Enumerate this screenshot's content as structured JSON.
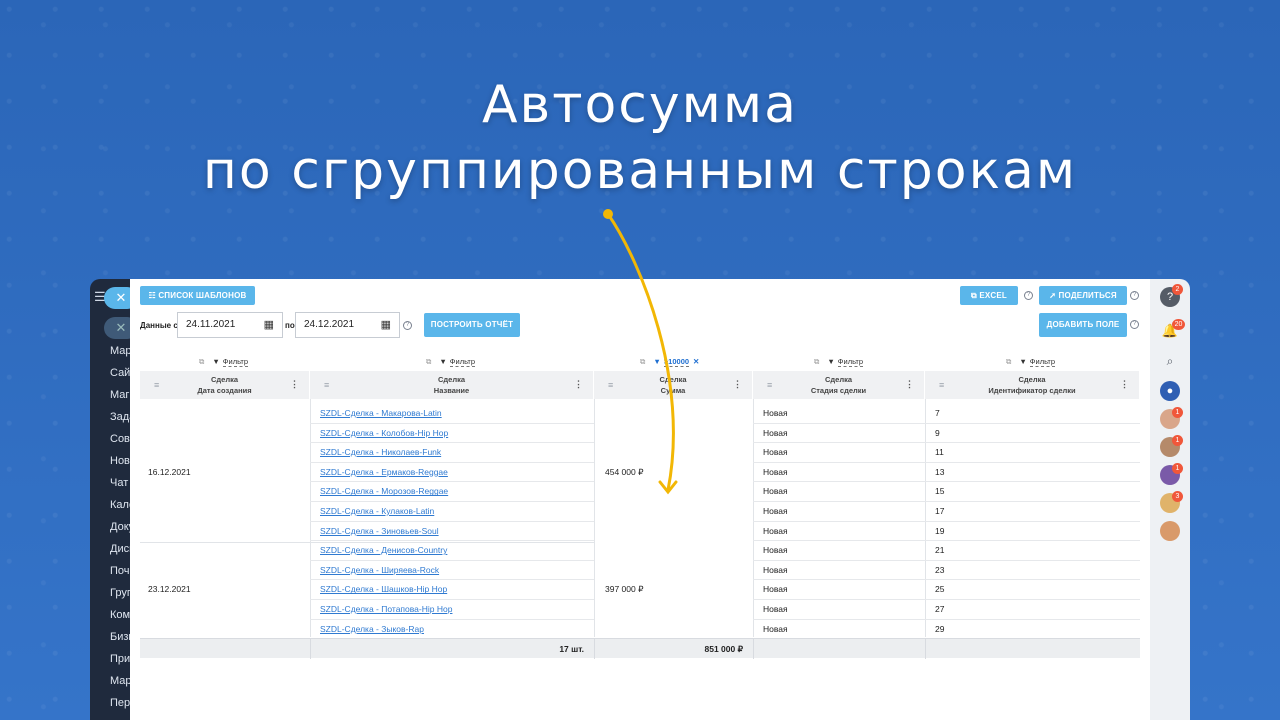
{
  "headline": {
    "line1": "Автосумма",
    "line2": "по сгруппированным строкам"
  },
  "left_sidebar": {
    "items": [
      "Мар",
      "Сайт",
      "Маг",
      "Зада",
      "Совм",
      "Нов",
      "Чат",
      "Кале",
      "Доку",
      "Диск",
      "Поч",
      "Груп",
      "Ком",
      "Бизн",
      "Прил",
      "Мар",
      "Пер"
    ]
  },
  "toolbar": {
    "templates_label": "СПИСОК ШАБЛОНОВ",
    "excel_label": "EXCEL",
    "share_label": "ПОДЕЛИТЬСЯ",
    "add_field_label": "ДОБАВИТЬ ПОЛЕ",
    "build_report_label": "ПОСТРОИТЬ ОТЧЁТ",
    "data_from_label": "Данные с",
    "to_label": "по",
    "date_from": "24.11.2021",
    "date_to": "24.12.2021"
  },
  "filters": {
    "label": "Фильтр",
    "active_value": ">10000"
  },
  "columns": [
    {
      "entity": "Сделка",
      "field": "Дата создания"
    },
    {
      "entity": "Сделка",
      "field": "Название"
    },
    {
      "entity": "Сделка",
      "field": "Сумма"
    },
    {
      "entity": "Сделка",
      "field": "Стадия сделки"
    },
    {
      "entity": "Сделка",
      "field": "Идентификатор сделки"
    }
  ],
  "groups": [
    {
      "date": "16.12.2021",
      "sum": "454 000 ₽",
      "rows": [
        {
          "name": "SZDL-Сделка - Макарова-Latin",
          "stage": "Новая",
          "id": "7"
        },
        {
          "name": "SZDL-Сделка - Колобов-Hip Hop",
          "stage": "Новая",
          "id": "9"
        },
        {
          "name": "SZDL-Сделка - Николаев-Funk",
          "stage": "Новая",
          "id": "11"
        },
        {
          "name": "SZDL-Сделка - Ермаков-Reggae",
          "stage": "Новая",
          "id": "13"
        },
        {
          "name": "SZDL-Сделка - Морозов-Reggae",
          "stage": "Новая",
          "id": "15"
        },
        {
          "name": "SZDL-Сделка - Кулаков-Latin",
          "stage": "Новая",
          "id": "17"
        },
        {
          "name": "SZDL-Сделка - Зиновьев-Soul",
          "stage": "Новая",
          "id": "19"
        }
      ]
    },
    {
      "date": "23.12.2021",
      "sum": "397 000 ₽",
      "rows": [
        {
          "name": "SZDL-Сделка - Денисов-Country",
          "stage": "Новая",
          "id": "21"
        },
        {
          "name": "SZDL-Сделка - Ширяева-Rock",
          "stage": "Новая",
          "id": "23"
        },
        {
          "name": "SZDL-Сделка - Шашков-Hip Hop",
          "stage": "Новая",
          "id": "25"
        },
        {
          "name": "SZDL-Сделка - Потапова-Hip Hop",
          "stage": "Новая",
          "id": "27"
        },
        {
          "name": "SZDL-Сделка - Зыков-Rap",
          "stage": "Новая",
          "id": "29"
        }
      ]
    }
  ],
  "totals": {
    "count": "17 шт.",
    "sum": "851 000 ₽"
  },
  "right_rail": {
    "help_badge": "2",
    "notifications_badge": "20",
    "avatar_badges": [
      "1",
      "1",
      "1",
      "3"
    ]
  },
  "colors": {
    "background": "#2f6dc0",
    "accent": "#5ab6ea",
    "link": "#2f7ad1",
    "arrow": "#f2b705"
  }
}
